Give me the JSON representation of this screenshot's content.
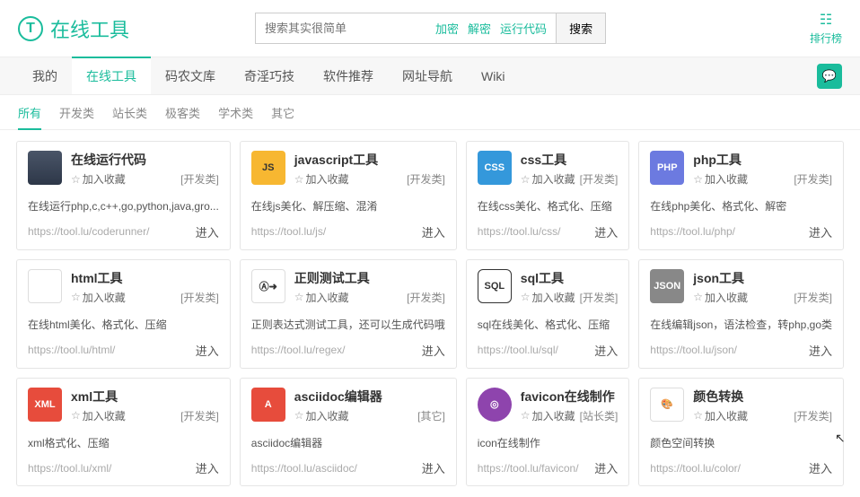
{
  "header": {
    "logo_letter": "T",
    "logo_text": "在线工具",
    "search_placeholder": "搜索其实很简单",
    "quick_links": [
      "加密",
      "解密",
      "运行代码"
    ],
    "search_btn": "搜索",
    "rank_label": "排行榜"
  },
  "nav_tabs": [
    "我的",
    "在线工具",
    "码农文库",
    "奇淫巧技",
    "软件推荐",
    "网址导航",
    "Wiki"
  ],
  "nav_active_index": 1,
  "sub_tabs": [
    "所有",
    "开发类",
    "站长类",
    "极客类",
    "学术类",
    "其它"
  ],
  "sub_active_index": 0,
  "fav_label": "加入收藏",
  "enter_label": "进入",
  "cards": [
    {
      "icon_class": "ic-code",
      "icon_text": "",
      "title": "在线运行代码",
      "category": "[开发类]",
      "desc": "在线运行php,c,c++,go,python,java,gro...",
      "url": "https://tool.lu/coderunner/"
    },
    {
      "icon_class": "ic-js",
      "icon_text": "JS",
      "title": "javascript工具",
      "category": "[开发类]",
      "desc": "在线js美化、解压缩、混淆",
      "url": "https://tool.lu/js/"
    },
    {
      "icon_class": "ic-css",
      "icon_text": "CSS",
      "title": "css工具",
      "category": "[开发类]",
      "desc": "在线css美化、格式化、压缩",
      "url": "https://tool.lu/css/"
    },
    {
      "icon_class": "ic-php",
      "icon_text": "PHP",
      "title": "php工具",
      "category": "[开发类]",
      "desc": "在线php美化、格式化、解密",
      "url": "https://tool.lu/php/"
    },
    {
      "icon_class": "ic-html",
      "icon_text": "",
      "title": "html工具",
      "category": "[开发类]",
      "desc": "在线html美化、格式化、压缩",
      "url": "https://tool.lu/html/"
    },
    {
      "icon_class": "ic-regex",
      "icon_text": "Ⓐ➜",
      "title": "正则测试工具",
      "category": "[开发类]",
      "desc": "正则表达式测试工具，还可以生成代码哦",
      "url": "https://tool.lu/regex/"
    },
    {
      "icon_class": "ic-sql",
      "icon_text": "SQL",
      "title": "sql工具",
      "category": "[开发类]",
      "desc": "sql在线美化、格式化、压缩",
      "url": "https://tool.lu/sql/"
    },
    {
      "icon_class": "ic-json",
      "icon_text": "JSON",
      "title": "json工具",
      "category": "[开发类]",
      "desc": "在线编辑json，语法检查，转php,go类",
      "url": "https://tool.lu/json/"
    },
    {
      "icon_class": "ic-xml",
      "icon_text": "XML",
      "title": "xml工具",
      "category": "[开发类]",
      "desc": "xml格式化、压缩",
      "url": "https://tool.lu/xml/"
    },
    {
      "icon_class": "ic-ascii",
      "icon_text": "A",
      "title": "asciidoc编辑器",
      "category": "[其它]",
      "desc": "asciidoc编辑器",
      "url": "https://tool.lu/asciidoc/"
    },
    {
      "icon_class": "ic-favicon",
      "icon_text": "◎",
      "title": "favicon在线制作",
      "category": "[站长类]",
      "desc": "icon在线制作",
      "url": "https://tool.lu/favicon/"
    },
    {
      "icon_class": "ic-color",
      "icon_text": "🎨",
      "title": "颜色转换",
      "category": "[开发类]",
      "desc": "颜色空间转换",
      "url": "https://tool.lu/color/"
    }
  ]
}
